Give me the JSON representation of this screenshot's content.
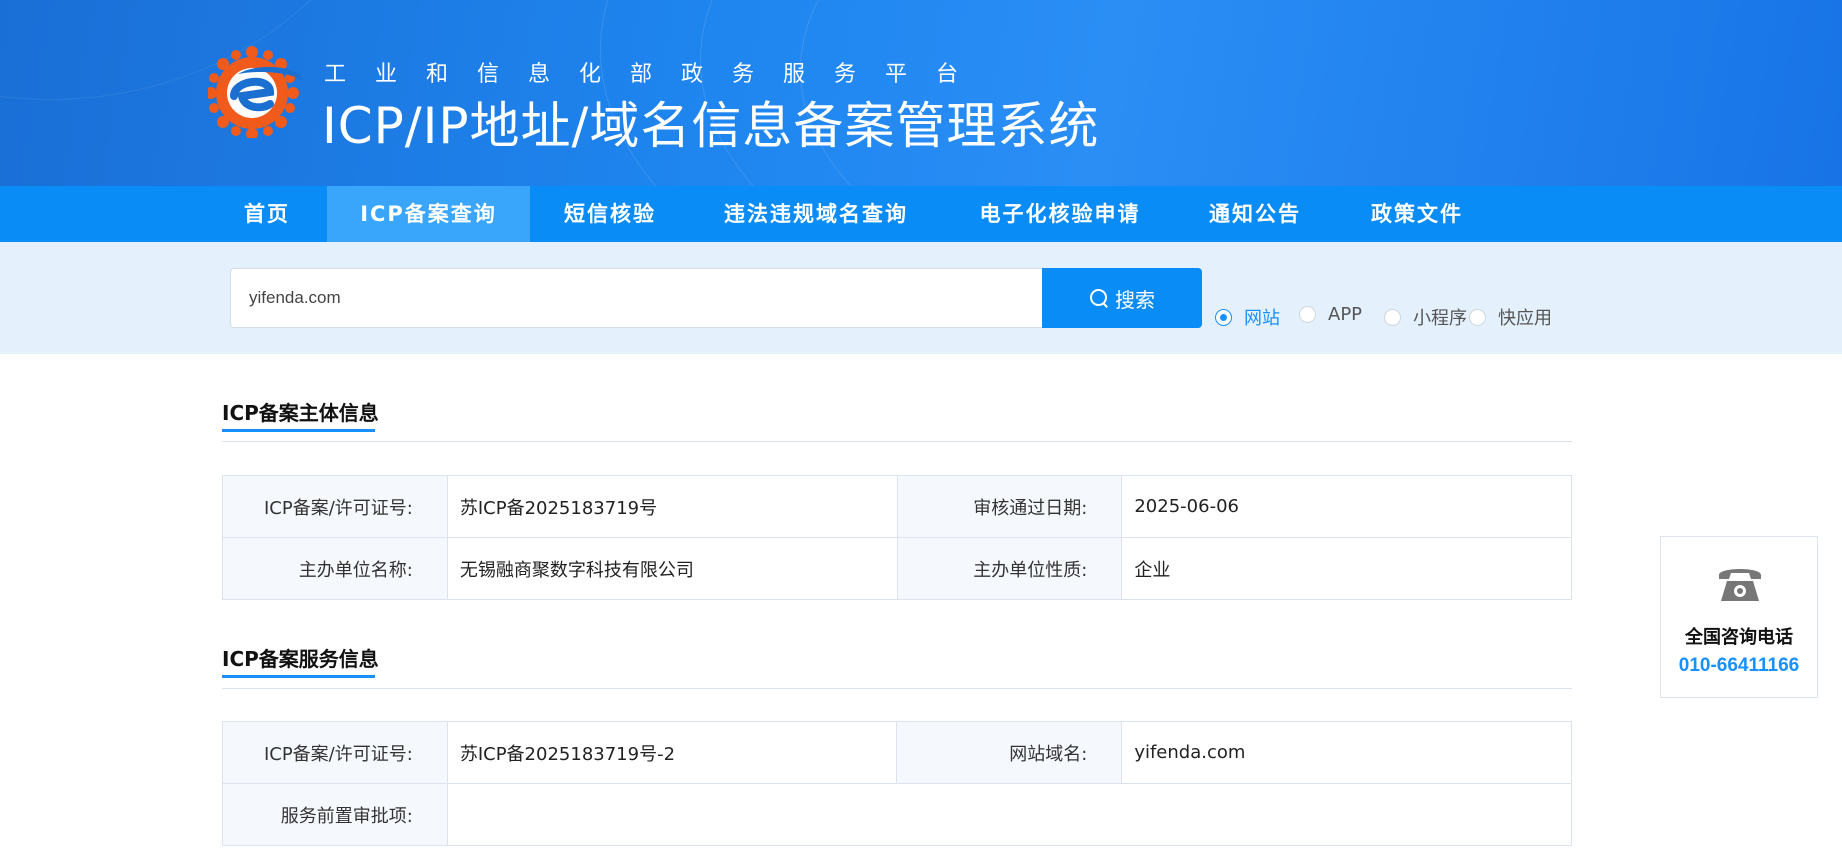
{
  "header": {
    "subtitle": "工业和信息化部政务服务平台",
    "title": "ICP/IP地址/域名信息备案管理系统"
  },
  "nav": {
    "items": [
      {
        "label": "首页",
        "active": false
      },
      {
        "label": "ICP备案查询",
        "active": true
      },
      {
        "label": "短信核验",
        "active": false
      },
      {
        "label": "违法违规域名查询",
        "active": false
      },
      {
        "label": "电子化核验申请",
        "active": false
      },
      {
        "label": "通知公告",
        "active": false
      },
      {
        "label": "政策文件",
        "active": false
      }
    ]
  },
  "search": {
    "value": "yifenda.com",
    "button_label": "搜索",
    "options": [
      {
        "label": "网站",
        "checked": true
      },
      {
        "label": "APP",
        "checked": false
      },
      {
        "label": "小程序",
        "checked": false
      },
      {
        "label": "快应用",
        "checked": false
      }
    ]
  },
  "subject_section": {
    "title": "ICP备案主体信息",
    "rows": [
      [
        {
          "label": "ICP备案/许可证号:",
          "value": "苏ICP备2025183719号"
        },
        {
          "label": "审核通过日期:",
          "value": "2025-06-06"
        }
      ],
      [
        {
          "label": "主办单位名称:",
          "value": "无锡融商聚数字科技有限公司"
        },
        {
          "label": "主办单位性质:",
          "value": "企业"
        }
      ]
    ]
  },
  "service_section": {
    "title": "ICP备案服务信息",
    "rows": [
      [
        {
          "label": "ICP备案/许可证号:",
          "value": "苏ICP备2025183719号-2"
        },
        {
          "label": "网站域名:",
          "value": "yifenda.com"
        }
      ],
      [
        {
          "label": "服务前置审批项:",
          "value": ""
        }
      ]
    ]
  },
  "contact": {
    "title": "全国咨询电话",
    "phone": "010-66411166"
  },
  "colors": {
    "primary": "#0a8cf7",
    "accent": "#1890ff",
    "logo_orange": "#f05a1a"
  }
}
